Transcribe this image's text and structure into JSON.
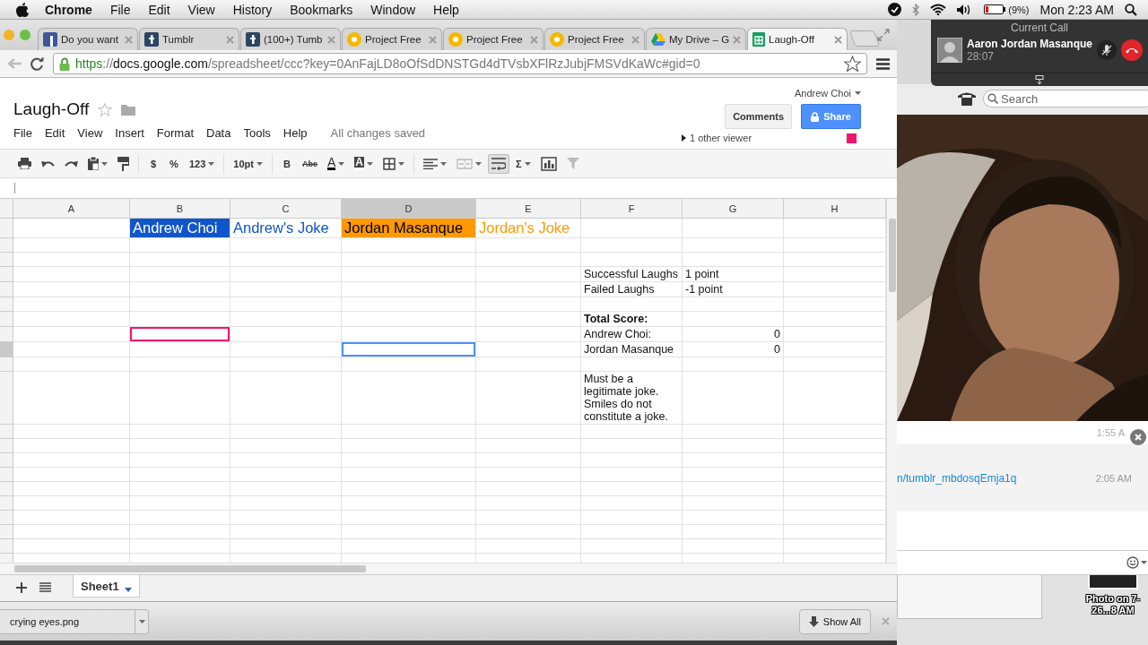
{
  "menubar": {
    "app": "Chrome",
    "menus": [
      "File",
      "Edit",
      "View",
      "History",
      "Bookmarks",
      "Window",
      "Help"
    ],
    "battery": "(9%)",
    "clock": "Mon 2:23 AM"
  },
  "browser": {
    "tabs": [
      {
        "title": "Do you want",
        "kind": "facebook",
        "selected": false
      },
      {
        "title": "Tumblr",
        "kind": "tumblr",
        "selected": false
      },
      {
        "title": "(100+) Tumb",
        "kind": "tumblr",
        "selected": false
      },
      {
        "title": "Project Free",
        "kind": "project",
        "selected": false
      },
      {
        "title": "Project Free",
        "kind": "project",
        "selected": false
      },
      {
        "title": "Project Free",
        "kind": "project",
        "selected": false
      },
      {
        "title": "My Drive – G",
        "kind": "drive",
        "selected": false
      },
      {
        "title": "Laugh-Off",
        "kind": "sheets",
        "selected": true
      }
    ],
    "url": {
      "scheme": "https",
      "separator": "://",
      "host": "docs.google.com",
      "path": "/spreadsheet/ccc?key=0AnFajLD8oOfSdDNSTGd4dTVsbXFlRzJubjFMSVdKaWc#gid=0"
    }
  },
  "document": {
    "title": "Laugh-Off",
    "user": "Andrew Choi",
    "comments_button": "Comments",
    "share_button": "Share",
    "menus": [
      "File",
      "Edit",
      "View",
      "Insert",
      "Format",
      "Data",
      "Tools",
      "Help"
    ],
    "save_status": "All changes saved",
    "viewers": {
      "label": "1 other viewer",
      "color": "#f0166e"
    }
  },
  "toolbar": [
    [
      {
        "kind": "print",
        "disabled": false,
        "selected": false
      },
      {
        "kind": "undo",
        "disabled": false,
        "selected": false
      },
      {
        "kind": "redo",
        "disabled": false,
        "selected": false
      },
      {
        "kind": "clipboard",
        "disabled": false,
        "selected": false
      },
      {
        "kind": "roller",
        "disabled": false,
        "selected": false
      }
    ],
    [
      {
        "kind": "text",
        "label": "$",
        "disabled": false,
        "selected": false
      },
      {
        "kind": "text",
        "label": "%",
        "disabled": false,
        "selected": false
      },
      {
        "kind": "text-menu",
        "label": "123",
        "disabled": false,
        "selected": false
      }
    ],
    [
      {
        "kind": "text-menu",
        "label": "10pt",
        "disabled": false,
        "selected": false
      }
    ],
    [
      {
        "kind": "text",
        "label": "B",
        "disabled": false,
        "selected": false
      },
      {
        "kind": "strike",
        "label": "Abc",
        "disabled": false,
        "selected": false
      },
      {
        "kind": "text-color",
        "label": "A",
        "disabled": false,
        "selected": false
      },
      {
        "kind": "fill-color",
        "label": "A",
        "disabled": false,
        "selected": false
      },
      {
        "kind": "borders",
        "disabled": false,
        "selected": false
      }
    ],
    [
      {
        "kind": "align",
        "disabled": false,
        "selected": false
      },
      {
        "kind": "merge",
        "disabled": true,
        "selected": false
      },
      {
        "kind": "wrap",
        "disabled": false,
        "selected": true
      },
      {
        "kind": "text-menu",
        "label": "Σ",
        "disabled": false,
        "selected": false
      },
      {
        "kind": "chart",
        "disabled": false,
        "selected": false
      },
      {
        "kind": "filter",
        "disabled": true,
        "selected": false
      }
    ]
  ],
  "sheet": {
    "columns": [
      {
        "label": "A",
        "selected": false
      },
      {
        "label": "B",
        "selected": false
      },
      {
        "label": "C",
        "selected": false
      },
      {
        "label": "D",
        "selected": true
      },
      {
        "label": "E",
        "selected": false
      },
      {
        "label": "F",
        "selected": false
      },
      {
        "label": "G",
        "selected": false
      },
      {
        "label": "H",
        "selected": false
      }
    ],
    "rows": [
      {
        "cells": {
          "B": {
            "text": "Andrew Choi",
            "kind": "blue-fill"
          },
          "C": {
            "text": "Andrew's Joke",
            "kind": "blue-text"
          },
          "D": {
            "text": "Jordan Masanque",
            "kind": "orange-fill"
          },
          "E": {
            "text": "Jordan's Joke",
            "kind": "orange-text"
          }
        }
      },
      {},
      {},
      {
        "cells": {
          "F": {
            "text": "Successful Laughs",
            "kind": "plain"
          },
          "G": {
            "text": "1 point",
            "kind": "plain"
          }
        }
      },
      {
        "cells": {
          "F": {
            "text": "Failed Laughs",
            "kind": "plain"
          },
          "G": {
            "text": "-1 point",
            "kind": "plain"
          }
        }
      },
      {},
      {
        "cells": {
          "F": {
            "text": "Total Score:",
            "kind": "bold"
          }
        }
      },
      {
        "cells": {
          "B": {
            "viewer_selected": true
          },
          "F": {
            "text": "Andrew Choi:",
            "kind": "plain"
          },
          "G": {
            "text": "0",
            "kind": "number"
          }
        }
      },
      {
        "cells": {
          "D": {
            "selected": true
          },
          "F": {
            "text": "Jordan Masanque",
            "kind": "plain"
          },
          "G": {
            "text": "0",
            "kind": "number"
          }
        }
      },
      {},
      {
        "cells": {
          "F": {
            "text": "Must be a legitimate joke. Smiles do not constitute a joke.",
            "kind": "plain"
          }
        }
      }
    ],
    "tabs": [
      {
        "label": "Sheet1",
        "selected": true
      }
    ]
  },
  "downloads": {
    "file": "crying eyes.png",
    "show_all": "Show All"
  },
  "skype": {
    "search": {
      "placeholder": "Search"
    },
    "call": {
      "heading": "Current Call",
      "name": "Aaron Jordan Masanque",
      "duration": "28:07"
    },
    "messages": [
      {
        "time": "1:55 A"
      },
      {
        "text": "n/tumblr_mbdosqEmja1q",
        "time": "2:05 AM"
      }
    ],
    "desktop_item": "Photo on 7-26...8 AM"
  }
}
